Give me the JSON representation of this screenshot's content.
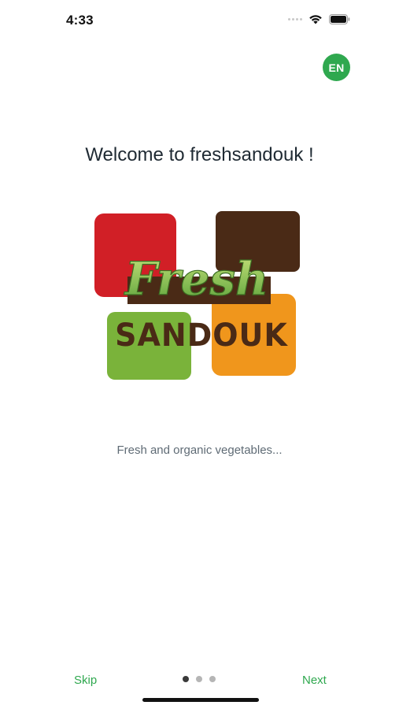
{
  "status_bar": {
    "time": "4:33"
  },
  "language": {
    "code": "EN",
    "color": "#2fa84f"
  },
  "welcome": {
    "title": "Welcome to freshsandouk !"
  },
  "logo": {
    "word_top": "Fresh",
    "word_bottom": "SANDOUK",
    "colors": {
      "red": "#d11f26",
      "brown": "#4a2a16",
      "green": "#7ab33a",
      "orange": "#f0961c"
    }
  },
  "slide": {
    "tagline": "Fresh and organic vegetables...",
    "current_page": 1,
    "total_pages": 3
  },
  "navigation": {
    "skip_label": "Skip",
    "next_label": "Next",
    "accent_color": "#2fa84f"
  }
}
